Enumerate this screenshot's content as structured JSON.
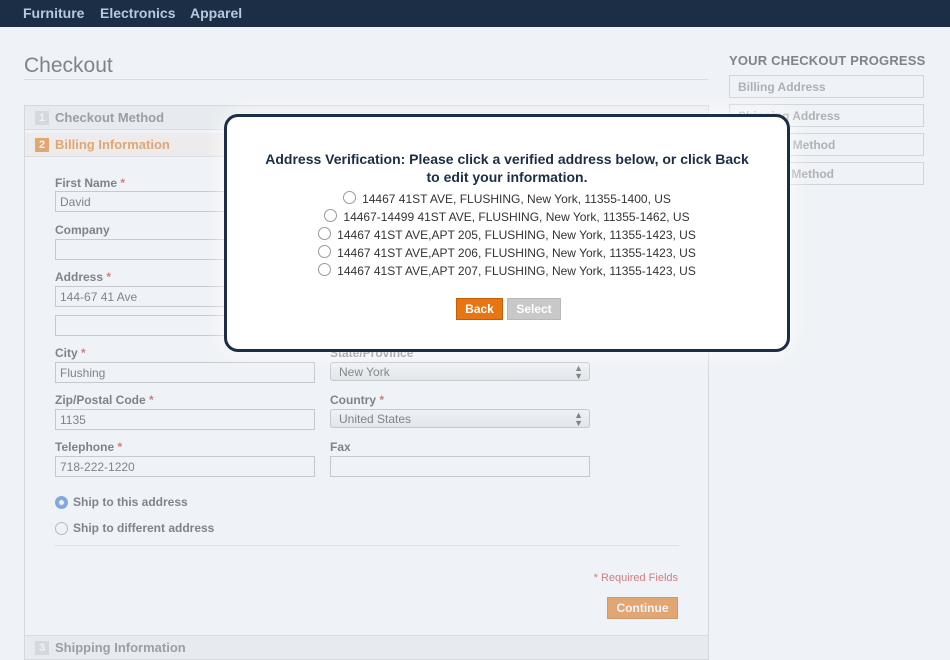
{
  "nav": {
    "items": [
      "Furniture",
      "Electronics",
      "Apparel"
    ]
  },
  "page": {
    "title": "Checkout"
  },
  "steps": [
    {
      "num": "1",
      "label": "Checkout Method"
    },
    {
      "num": "2",
      "label": "Billing Information"
    },
    {
      "num": "3",
      "label": "Shipping Information"
    }
  ],
  "form": {
    "first_name": {
      "label": "First Name",
      "value": "David"
    },
    "company": {
      "label": "Company",
      "value": ""
    },
    "address": {
      "label": "Address",
      "value": "144-67 41 Ave",
      "value2": ""
    },
    "city": {
      "label": "City",
      "value": "Flushing"
    },
    "state": {
      "label": "State/Province",
      "value": "New York"
    },
    "zip": {
      "label": "Zip/Postal Code",
      "value": "1135"
    },
    "country": {
      "label": "Country",
      "value": "United States"
    },
    "telephone": {
      "label": "Telephone",
      "value": "718-222-1220"
    },
    "fax": {
      "label": "Fax",
      "value": ""
    },
    "required_marker": "*",
    "ship_options": [
      {
        "label": "Ship to this address",
        "selected": true
      },
      {
        "label": "Ship to different address",
        "selected": false
      }
    ],
    "required_note": "* Required Fields",
    "continue_label": "Continue"
  },
  "progress": {
    "title": "YOUR CHECKOUT PROGRESS",
    "items": [
      "Billing Address",
      "Shipping Address",
      "Shipping Method",
      "Payment Method"
    ]
  },
  "modal": {
    "title_line1": "Address Verification: Please click a verified address below, or click Back",
    "title_line2": "to edit your information.",
    "addresses": [
      "14467 41ST AVE, FLUSHING, New York, 11355-1400, US",
      "14467-14499 41ST AVE, FLUSHING, New York, 11355-1462, US",
      "14467 41ST AVE,APT 205, FLUSHING, New York, 11355-1423, US",
      "14467 41ST AVE,APT 206, FLUSHING, New York, 11355-1423, US",
      "14467 41ST AVE,APT 207, FLUSHING, New York, 11355-1423, US"
    ],
    "back_label": "Back",
    "select_label": "Select"
  },
  "colors": {
    "nav_bg": "#1b2e45",
    "accent": "#e87511",
    "required": "#c62a2a",
    "radio_selected": "#3a7bd5"
  }
}
